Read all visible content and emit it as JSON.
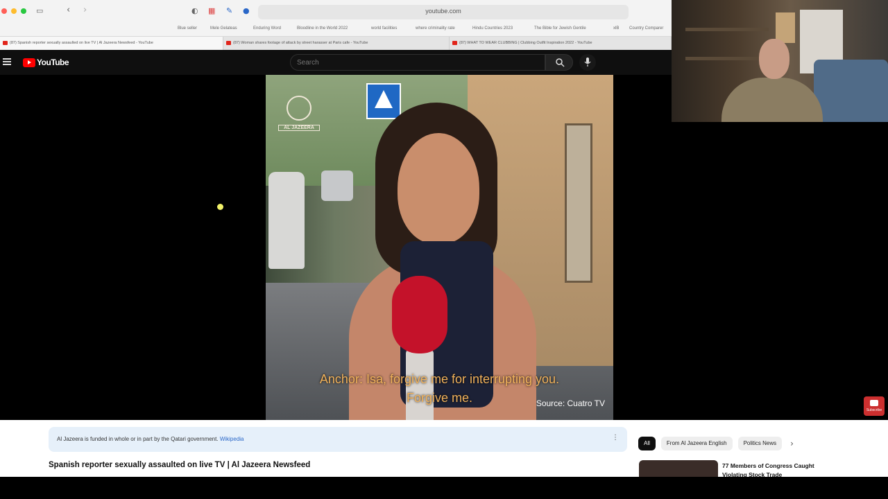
{
  "browser": {
    "url": "youtube.com",
    "bookmarks": [
      "Blue seller",
      "Mele Gelateas",
      "Enduring Word",
      "Bloodline in the World 2022",
      "world facilities",
      "where criminality rate",
      "Hindu Countries 2023",
      "The Bible for Jewish Gentile",
      "xlB",
      "Country Comparer"
    ],
    "tabs": [
      "(87) Spanish reporter sexually assaulted on live TV | Al Jazeera Newsfeed - YouTube",
      "(87) Woman shares footage of attack by street harasser at Paris cafe - YouTube",
      "(87) WHAT TO WEAR CLUBBING | Clubbing Outfit Inspiration 2022 - YouTube"
    ]
  },
  "youtube": {
    "logo_text": "YouTube",
    "search_placeholder": "Search"
  },
  "video": {
    "channel_logo_text": "AL JAZEERA",
    "subtitle_line1": "Anchor: Isa, forgive me for interrupting you.",
    "subtitle_line2": "Forgive me.",
    "source": "Source: Cuatro TV"
  },
  "below": {
    "info_text": "Al Jazeera is funded in whole or in part by the Qatari government.",
    "info_link": "Wikipedia",
    "video_title": "Spanish reporter sexually assaulted on live TV | Al Jazeera Newsfeed",
    "chips": [
      "All",
      "From Al Jazeera English",
      "Politics News"
    ],
    "rec_title": "77 Members of Congress Caught Violating Stock Trade"
  },
  "badge": {
    "label": "Subscribe"
  },
  "colors": {
    "yt_red": "#ff0000",
    "subtitle": "#f0b15a",
    "info_bg": "#e6f0fa"
  }
}
